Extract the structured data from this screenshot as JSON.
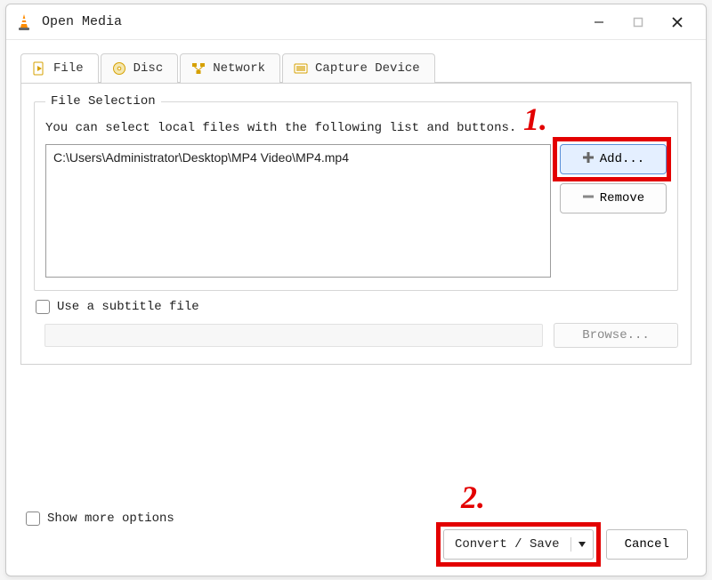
{
  "window": {
    "title": "Open Media"
  },
  "tabs": {
    "file": "File",
    "disc": "Disc",
    "network": "Network",
    "capture": "Capture Device"
  },
  "file_area": {
    "group_label": "File Selection",
    "hint": "You can select local files with the following list and buttons.",
    "files": [
      "C:\\Users\\Administrator\\Desktop\\MP4 Video\\MP4.mp4"
    ],
    "add_label": "Add...",
    "remove_label": "Remove"
  },
  "subtitle": {
    "checkbox_label": "Use a subtitle file",
    "browse_label": "Browse..."
  },
  "options": {
    "show_more": "Show more options"
  },
  "footer": {
    "convert_label": "Convert / Save",
    "cancel_label": "Cancel"
  },
  "annotations": {
    "one": "1.",
    "two": "2."
  },
  "colors": {
    "accent_highlight": "#e30000"
  }
}
